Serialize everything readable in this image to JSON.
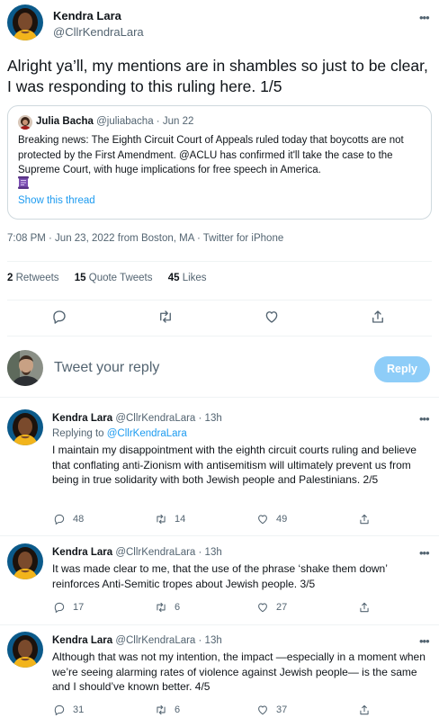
{
  "main_tweet": {
    "author_name": "Kendra Lara",
    "author_handle": "@CllrKendraLara",
    "text": "Alright ya’ll, my mentions are in shambles so just to be clear, I was responding to this ruling here. 1/5",
    "quoted": {
      "author_name": "Julia Bacha",
      "author_handle": "@juliabacha",
      "date": "Jun 22",
      "text": "Breaking news: The Eighth Circuit Court of Appeals ruled today that boycotts are not protected by the First Amendment. @ACLU has confirmed it'll take the case to the Supreme Court, with huge implications for free speech in America.",
      "show_thread": "Show this thread"
    },
    "timestamp": "7:08 PM · Jun 23, 2022 from Boston, MA · Twitter for iPhone",
    "stats": {
      "retweets_count": "2",
      "retweets_label": "Retweets",
      "quotes_count": "15",
      "quotes_label": "Quote Tweets",
      "likes_count": "45",
      "likes_label": "Likes"
    }
  },
  "composer": {
    "placeholder": "Tweet your reply",
    "button_label": "Reply"
  },
  "replies": [
    {
      "author_name": "Kendra Lara",
      "handle_time": "@CllrKendraLara · 13h",
      "replying_prefix": "Replying to",
      "replying_to": "@CllrKendraLara",
      "text": "I maintain my disappointment with the eighth circuit courts ruling and believe that conflating anti-Zionism with antisemitism will ultimately prevent us from being in true solidarity with both Jewish people and Palestinians. 2/5",
      "replies": "48",
      "retweets": "14",
      "likes": "49"
    },
    {
      "author_name": "Kendra Lara",
      "handle_time": "@CllrKendraLara · 13h",
      "text": "It was made clear to me, that the use of the phrase ‘shake them down’ reinforces Anti-Semitic  tropes about Jewish people. 3/5",
      "replies": "17",
      "retweets": "6",
      "likes": "27"
    },
    {
      "author_name": "Kendra Lara",
      "handle_time": "@CllrKendraLara · 13h",
      "text": "Although that was not my intention, the impact —especially in a moment when we’re seeing alarming rates of violence against Jewish people— is the same and I should’ve known better. 4/5",
      "replies": "31",
      "retweets": "6",
      "likes": "37"
    }
  ],
  "icons": {
    "more": "more-horizontal-icon",
    "reply": "reply-icon",
    "retweet": "retweet-icon",
    "like": "heart-icon",
    "share": "share-icon",
    "emoji": "scroll-emoji-icon"
  },
  "colors": {
    "accent": "#1d9bf0",
    "reply_button_disabled": "#8ecdf8",
    "secondary_text": "#536471",
    "border": "#cfd9de"
  }
}
